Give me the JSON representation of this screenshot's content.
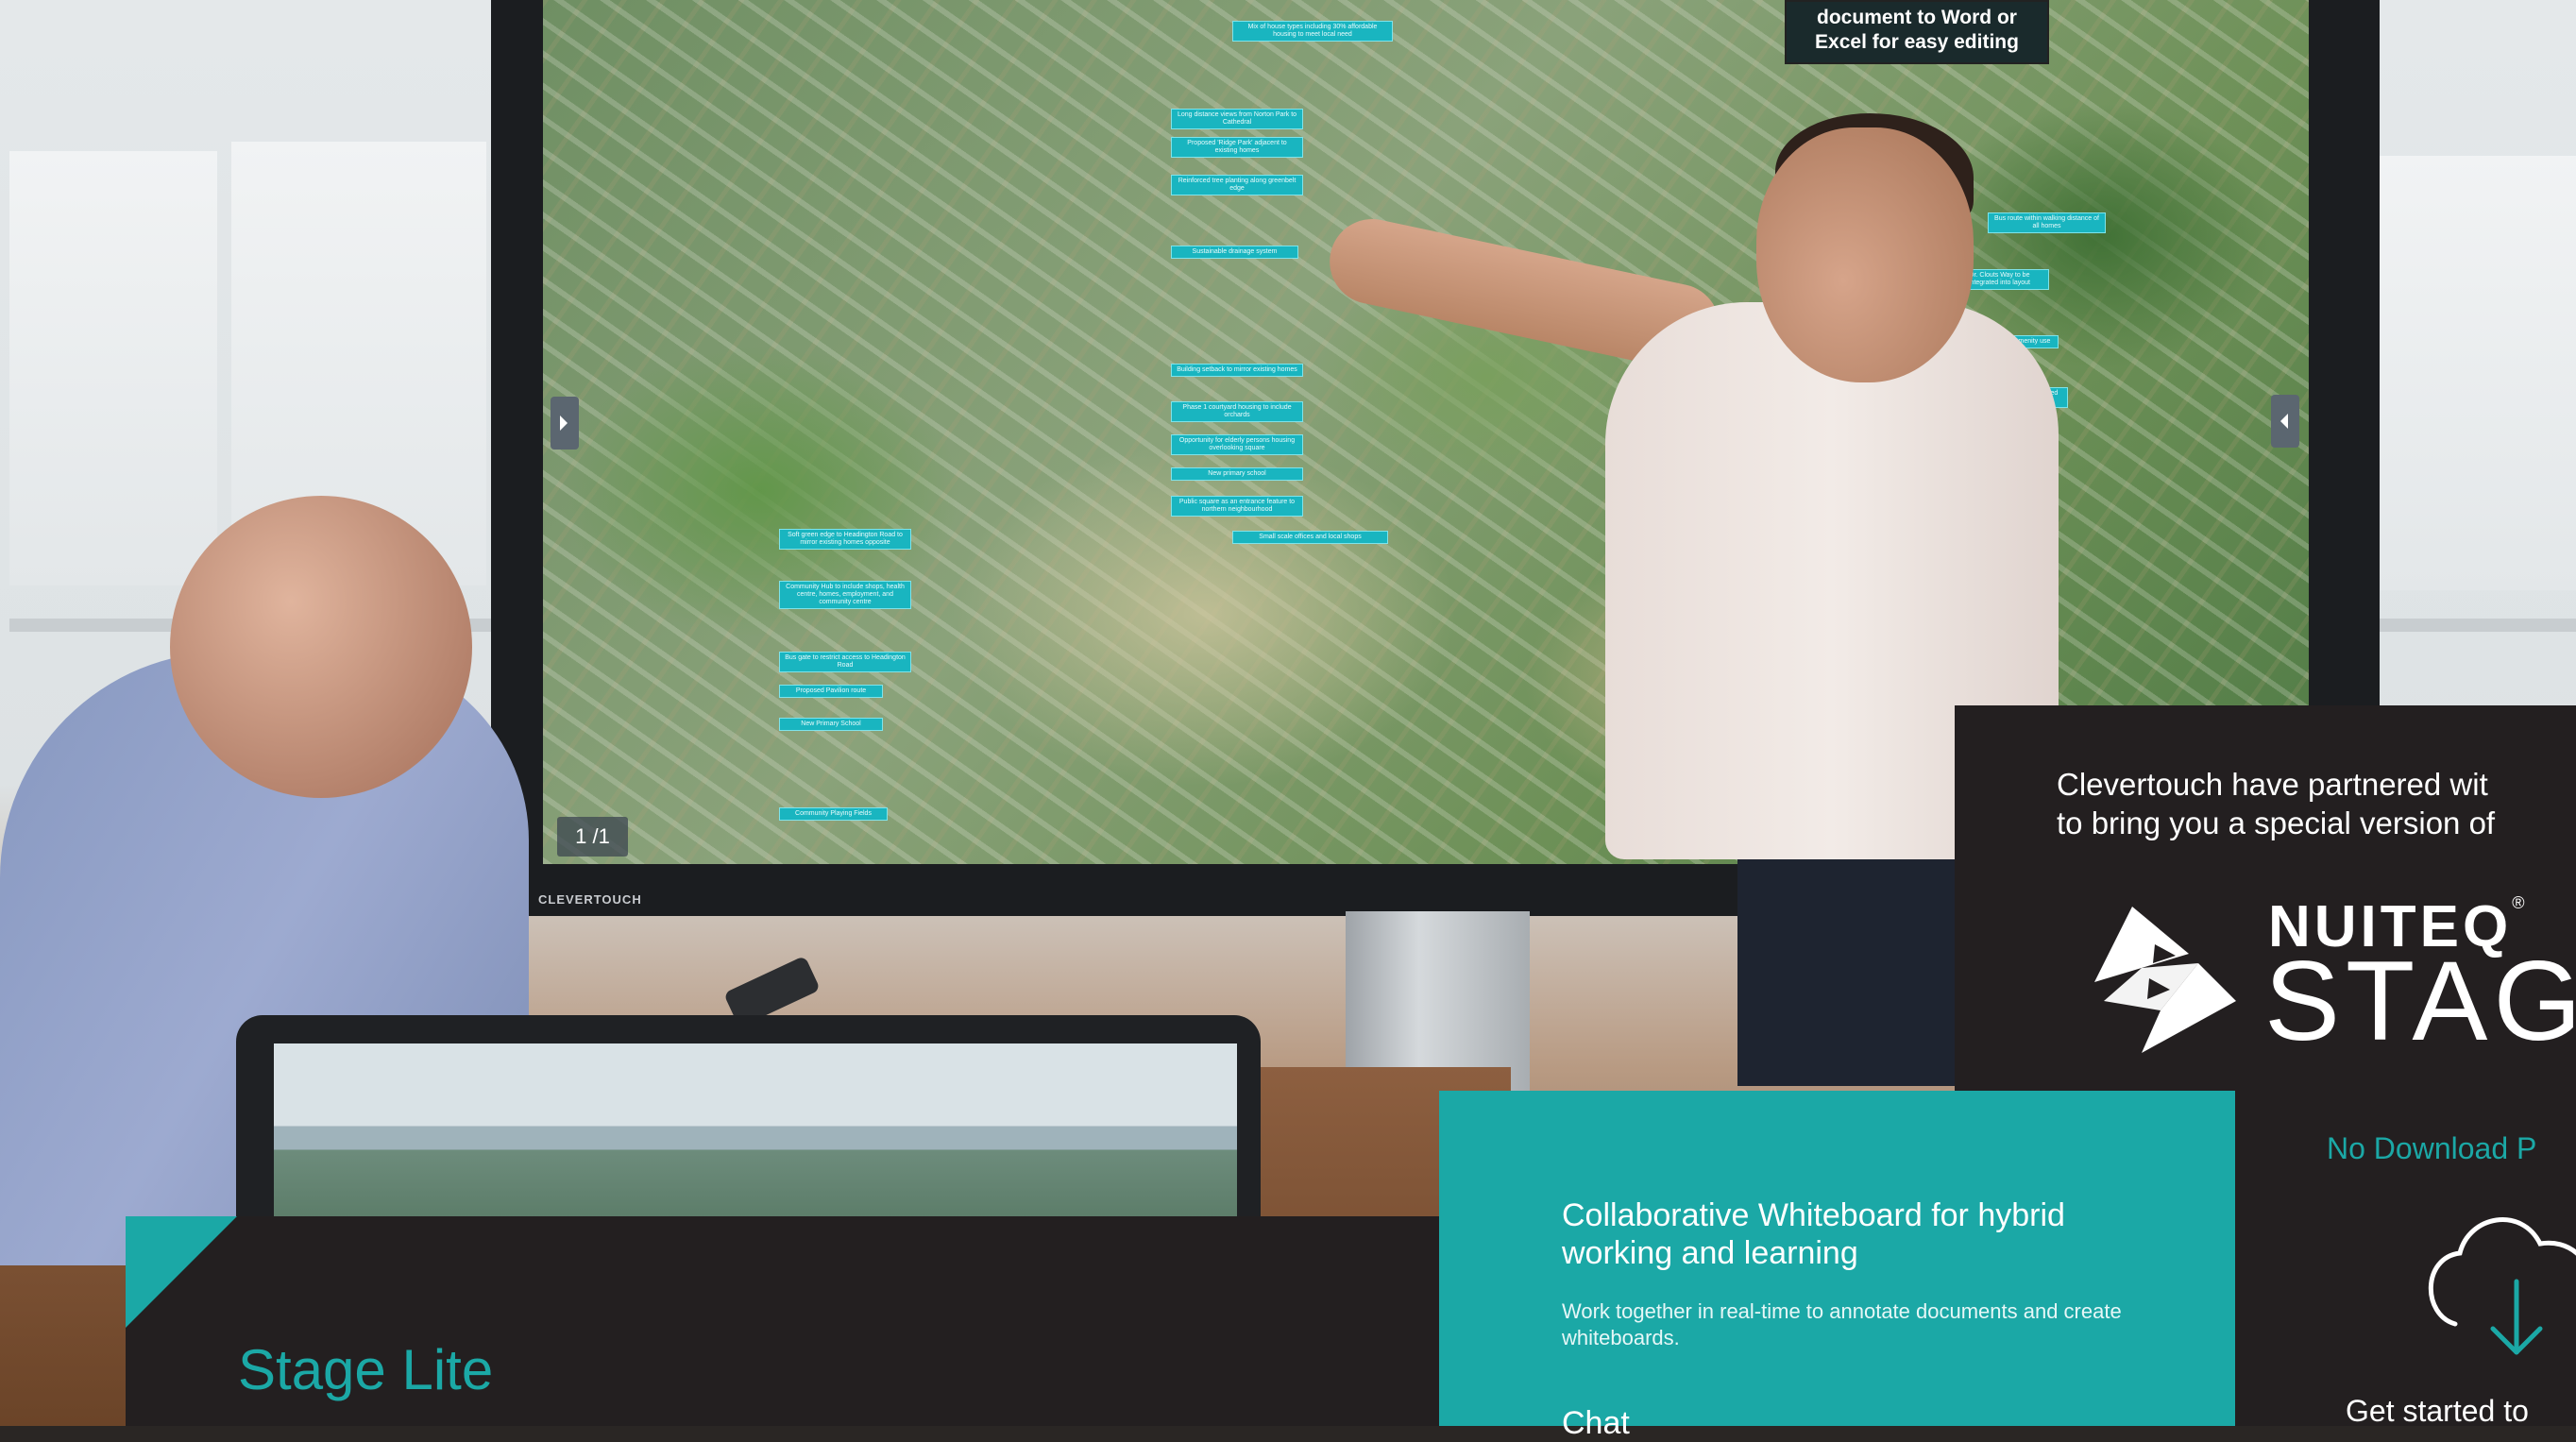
{
  "photo": {
    "screen_callouts": [
      "Mix of house types including 30% affordable housing to meet local need",
      "Long distance views from Norton Park to Cathedral",
      "Proposed 'Ridge Park' adjacent to existing homes",
      "Reinforced tree planting along greenbelt edge",
      "Sustainable drainage system",
      "Building setback to mirror existing homes",
      "Phase 1 courtyard housing to include orchards",
      "Opportunity for elderly persons housing overlooking square",
      "New primary school",
      "Public square as an entrance feature to northern neighbourhood",
      "Small scale offices and local shops",
      "Soft green edge to Headington Road to mirror existing homes opposite",
      "Community Hub to include shops, health centre, homes, employment, and community centre",
      "Bus gate to restrict access to Headington Road",
      "Proposed Pavilion route",
      "New Primary School",
      "Community Playing Fields",
      "Bus route within walking distance of all homes",
      "Dr. Clouts Way to be integrated into layout",
      "Retained for amenity use",
      "Existing woodland retained and enhanced"
    ],
    "screen_callout_dark": "document to Word or Excel for easy editing",
    "page_indicator": "1 /1",
    "tv_brand": "CLEVERTOUCH"
  },
  "right_panel": {
    "partner_line1": "Clevertouch have partnered wit",
    "partner_line2": "to bring you a special version of",
    "logo_brand": "NUITEQ",
    "logo_product": "STAG",
    "no_download": "No Download P",
    "get_started": "Get started to"
  },
  "teal_panel": {
    "heading": "Collaborative Whiteboard for hybrid working and learning",
    "body": "Work together in real-time to annotate documents and create whiteboards.",
    "next_heading": "Chat"
  },
  "bottom_panel": {
    "title": "Stage Lite"
  },
  "colors": {
    "accent_teal": "#1ba8a6",
    "panel_dark": "#231f20"
  },
  "icons": [
    "stage-logo-icon",
    "cloud-download-icon",
    "chevron-left-icon",
    "chevron-right-icon"
  ]
}
